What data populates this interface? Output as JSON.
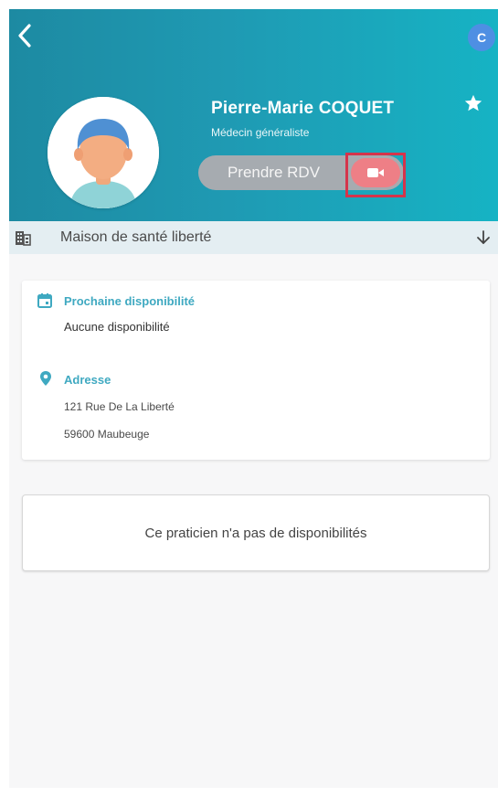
{
  "header": {
    "back_icon": "chevron-left-icon",
    "user_initial": "C",
    "favorite_icon": "star-icon"
  },
  "doctor": {
    "name": "Pierre-Marie COQUET",
    "specialty": "Médecin généraliste",
    "avatar_icon": "user-avatar-icon"
  },
  "actions": {
    "appointment_label": "Prendre RDV",
    "video_icon": "video-camera-icon"
  },
  "clinic": {
    "icon": "building-icon",
    "name": "Maison de santé liberté",
    "expand_icon": "arrow-down-icon"
  },
  "availability": {
    "icon": "calendar-icon",
    "title": "Prochaine disponibilité",
    "value": "Aucune disponibilité"
  },
  "address": {
    "icon": "map-pin-icon",
    "title": "Adresse",
    "line1": "121 Rue De La Liberté",
    "line2": "59600 Maubeuge"
  },
  "empty_state": {
    "message": "Ce praticien n'a pas de disponibilités"
  },
  "colors": {
    "header_start": "#1d8aa2",
    "header_end": "#16b3c4",
    "accent": "#3fa9c1",
    "video_button": "#ee7f86",
    "highlight": "#d5344b",
    "badge": "#4e8fe3"
  }
}
